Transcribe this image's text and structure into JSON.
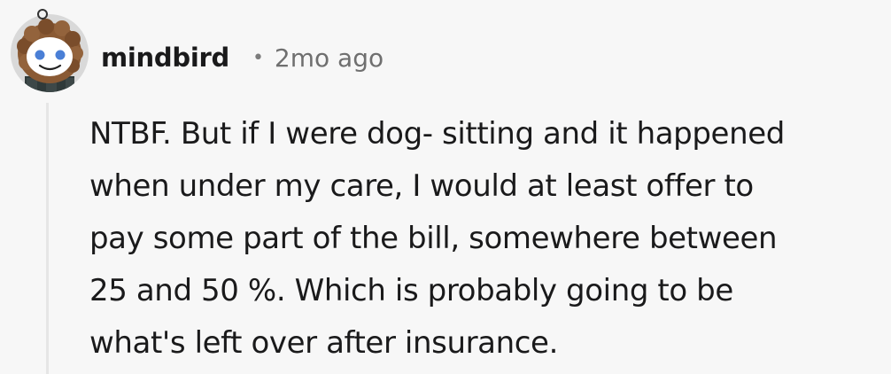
{
  "comment": {
    "author": "mindbird",
    "separator": "•",
    "timestamp": "2mo ago",
    "body_lines": [
      "NTBF. But if I were dog- sitting and it happened",
      "when under my care, I would at least offer to",
      "pay some part of the bill, somewhere between",
      "25 and 50 %. Which is probably going to be",
      "what's left over after insurance."
    ]
  },
  "icons": {
    "avatar": "avatar-icon"
  },
  "colors": {
    "background": "#f7f7f7",
    "text": "#1a1a1b",
    "meta": "#6f6f6f",
    "thread_line": "#e6e6e6"
  }
}
